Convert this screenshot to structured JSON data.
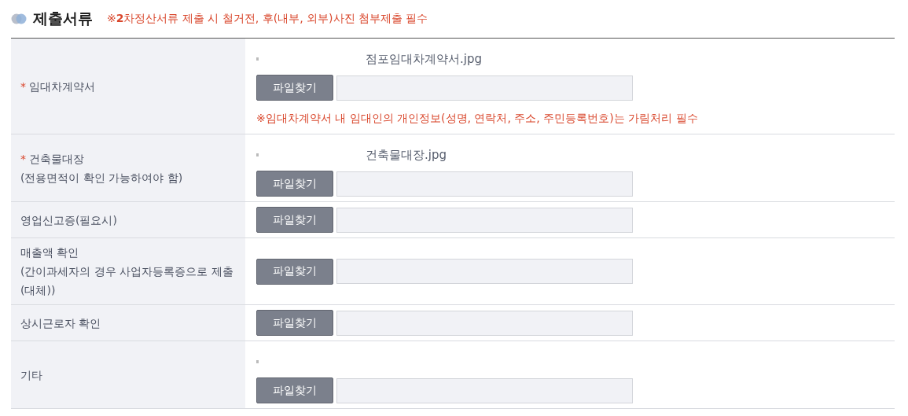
{
  "section": {
    "title": "제출서류",
    "notice": "※**2**차정산서류 제출 시 철거전, 후(내부, 외부)사진 첨부제출 필수"
  },
  "rows": [
    {
      "label": [
        "임대차계약서"
      ],
      "required_mark": "*",
      "bullet": true,
      "file": "점포임대차계약서.jpg",
      "button": "파일찾기",
      "note": "※임대차계약서 내 임대인의 개인정보(성명, 연락처, 주소, 주민등록번호)는 가림처리 필수"
    },
    {
      "label": [
        "건축물대장",
        "(전용면적이 확인 가능하여야 함)"
      ],
      "required_mark": "*",
      "bullet": true,
      "file": "건축물대장.jpg",
      "button": "파일찾기"
    },
    {
      "label": [
        "영업신고증(필요시)"
      ],
      "bullet": false,
      "button": "파일찾기"
    },
    {
      "label": [
        "매출액 확인",
        "(간이과세자의 경우 사업자등록증으로 제출(대체))"
      ],
      "bullet": false,
      "button": "파일찾기"
    },
    {
      "label": [
        "상시근로자 확인"
      ],
      "bullet": false,
      "button": "파일찾기"
    },
    {
      "label": [
        "기타"
      ],
      "bullet": true,
      "button": "파일찾기"
    }
  ]
}
